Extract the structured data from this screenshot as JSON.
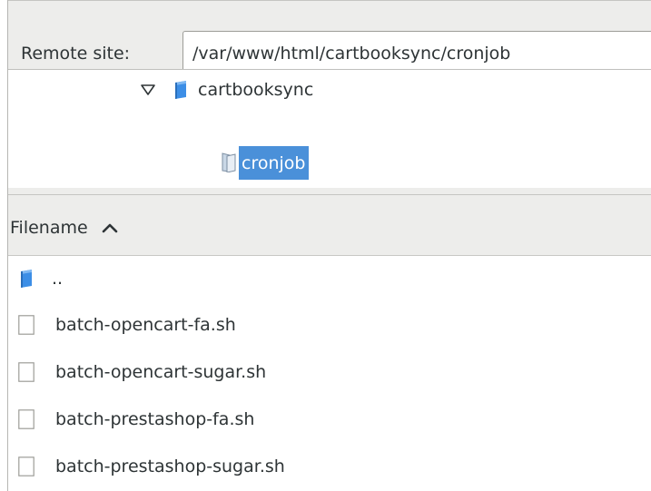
{
  "remote_site": {
    "label": "Remote site:",
    "path_value": "/var/www/html/cartbooksync/cronjob"
  },
  "tree": {
    "items": [
      {
        "label": "cartbooksync",
        "icon": "folder-icon",
        "expanded": true
      },
      {
        "label": "cronjob",
        "icon": "folder-open-icon",
        "selected": true
      }
    ]
  },
  "file_list": {
    "columns": [
      {
        "label": "Filename",
        "sort": "ascending",
        "icon": "sort-ascending-icon"
      }
    ],
    "rows": [
      {
        "name": "..",
        "icon": "folder-icon"
      },
      {
        "name": "batch-opencart-fa.sh",
        "icon": "file-icon"
      },
      {
        "name": "batch-opencart-sugar.sh",
        "icon": "file-icon"
      },
      {
        "name": "batch-prestashop-fa.sh",
        "icon": "file-icon"
      },
      {
        "name": "batch-prestashop-sugar.sh",
        "icon": "file-icon"
      }
    ]
  },
  "colors": {
    "selection": "#4a90d9",
    "chrome_background": "#ededeb",
    "folder_blue": "#3c8ee6"
  }
}
